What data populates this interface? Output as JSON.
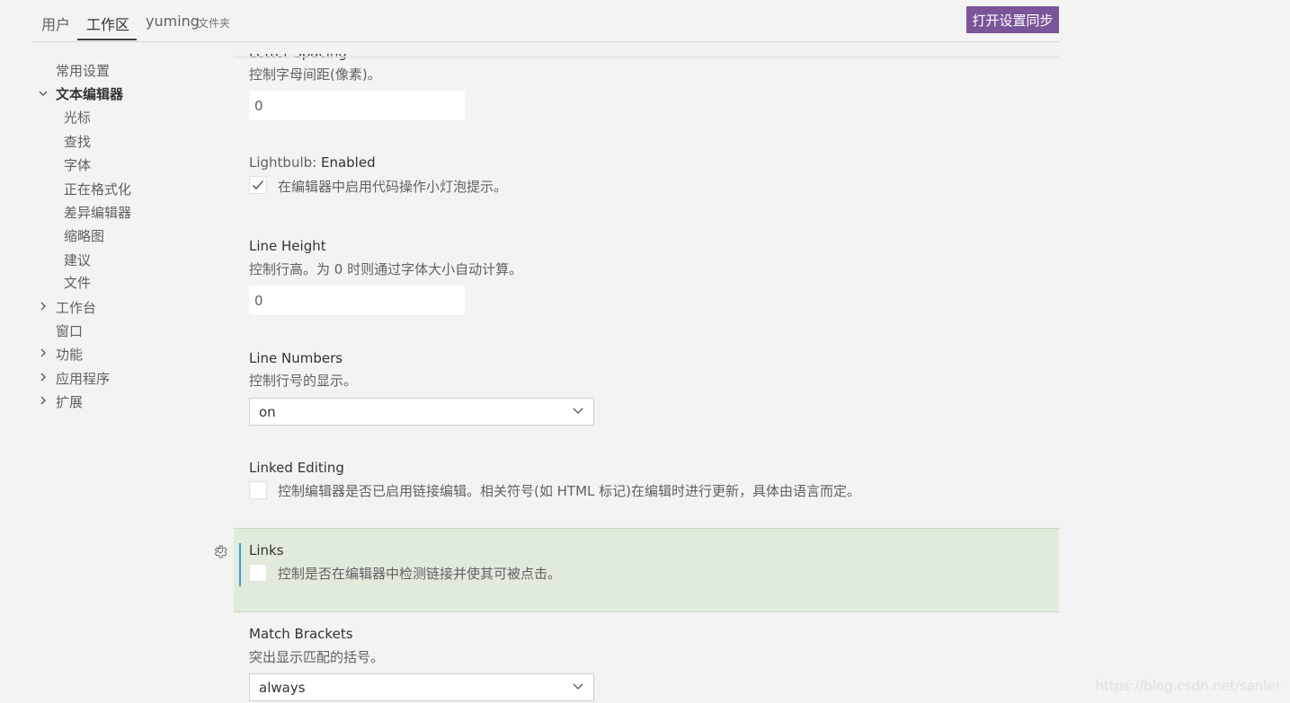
{
  "tabs": {
    "user": "用户",
    "workspace": "工作区",
    "folder": "yuming",
    "folder_sub": "文件夹"
  },
  "sync_button": "打开设置同步",
  "sidebar": {
    "items": [
      {
        "label": "常用设置"
      },
      {
        "label": "文本编辑器"
      },
      {
        "label": "光标"
      },
      {
        "label": "查找"
      },
      {
        "label": "字体"
      },
      {
        "label": "正在格式化"
      },
      {
        "label": "差异编辑器"
      },
      {
        "label": "缩略图"
      },
      {
        "label": "建议"
      },
      {
        "label": "文件"
      },
      {
        "label": "工作台"
      },
      {
        "label": "窗口"
      },
      {
        "label": "功能"
      },
      {
        "label": "应用程序"
      },
      {
        "label": "扩展"
      }
    ]
  },
  "settings": {
    "letter_spacing": {
      "title": "Letter Spacing",
      "desc": "控制字母间距(像素)。",
      "value": "0"
    },
    "lightbulb": {
      "category": "Lightbulb: ",
      "title": "Enabled",
      "label": "在编辑器中启用代码操作小灯泡提示。",
      "checked": true
    },
    "line_height": {
      "title": "Line Height",
      "desc": "控制行高。为 0 时则通过字体大小自动计算。",
      "value": "0"
    },
    "line_numbers": {
      "title": "Line Numbers",
      "desc": "控制行号的显示。",
      "value": "on"
    },
    "linked_editing": {
      "title": "Linked Editing",
      "label": "控制编辑器是否已启用链接编辑。相关符号(如 HTML 标记)在编辑时进行更新，具体由语言而定。",
      "checked": false
    },
    "links": {
      "title": "Links",
      "label": "控制是否在编辑器中检测链接并使其可被点击。",
      "checked": false
    },
    "match_brackets": {
      "title": "Match Brackets",
      "desc": "突出显示匹配的括号。",
      "value": "always"
    }
  },
  "watermark": "https://blog.csdn.net/sanler",
  "colors": {
    "sync_button": "#7a5599",
    "focused_row": "#e1ebdc",
    "focus_bar": "#3c9bd5"
  }
}
